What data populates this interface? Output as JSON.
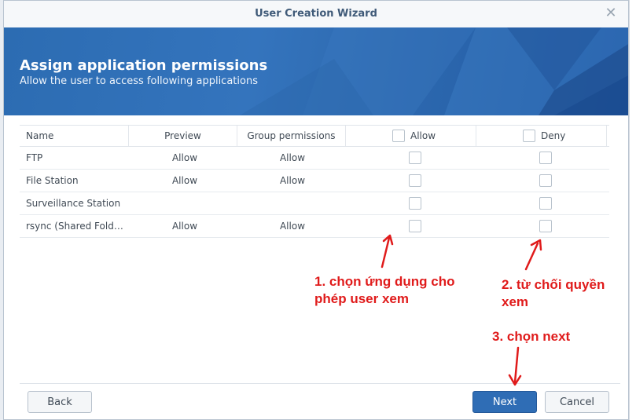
{
  "dialog": {
    "title": "User Creation Wizard"
  },
  "banner": {
    "title": "Assign application permissions",
    "subtitle": "Allow the user to access following applications"
  },
  "table": {
    "headers": {
      "name": "Name",
      "preview": "Preview",
      "group": "Group permissions",
      "allow": "Allow",
      "deny": "Deny"
    },
    "rows": [
      {
        "name": "FTP",
        "preview": "Allow",
        "group": "Allow"
      },
      {
        "name": "File Station",
        "preview": "Allow",
        "group": "Allow"
      },
      {
        "name": "Surveillance Station",
        "preview": "",
        "group": ""
      },
      {
        "name": "rsync (Shared Fold…",
        "preview": "Allow",
        "group": "Allow"
      }
    ]
  },
  "footer": {
    "back_label": "Back",
    "next_label": "Next",
    "cancel_label": "Cancel"
  },
  "annotations": {
    "step1": "1. chọn ứng dụng cho phép user xem",
    "step2": "2. từ chối quyền xem",
    "step3": "3. chọn next"
  },
  "colors": {
    "accent": "#2f6db5",
    "annotation": "#e01b1b",
    "title_text": "#3f5a78"
  }
}
